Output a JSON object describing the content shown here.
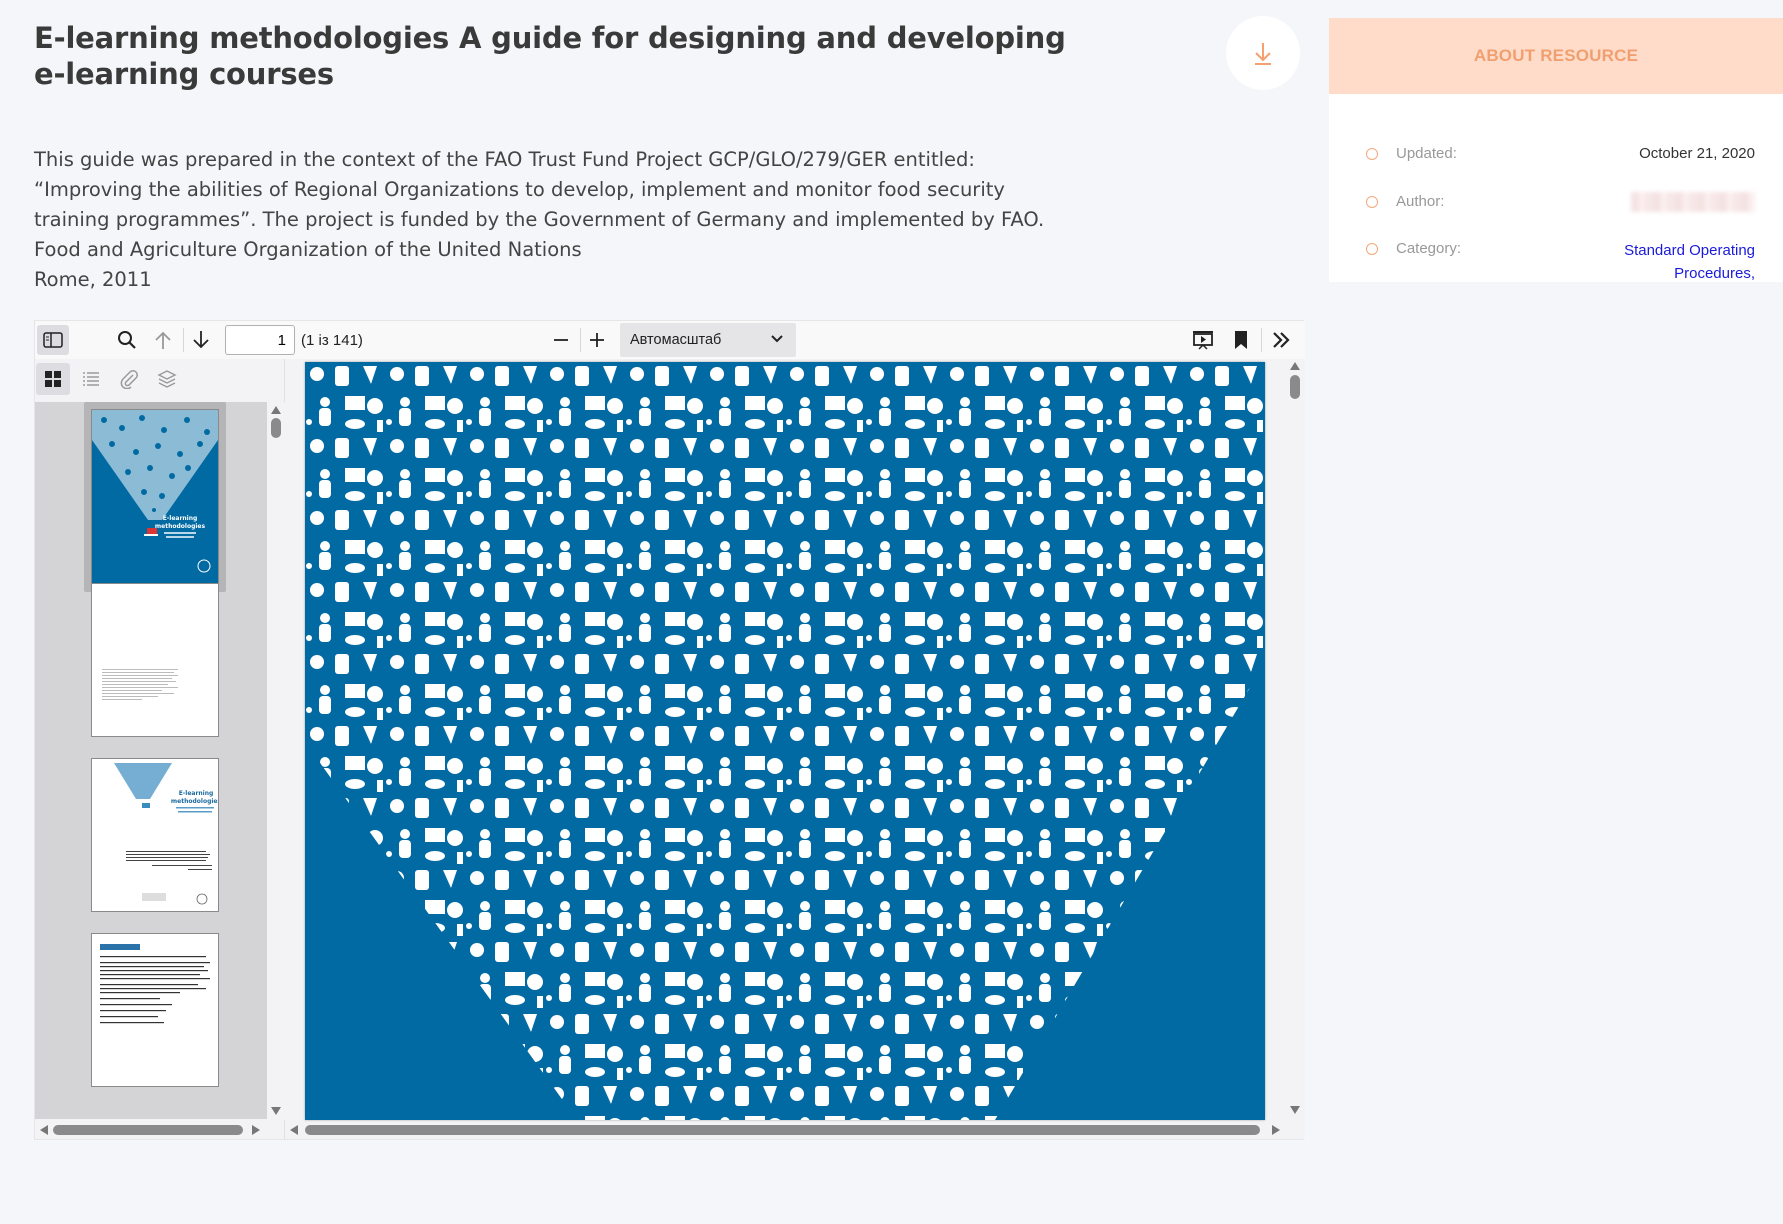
{
  "resource": {
    "title": "E-learning methodologies A guide for designing and developing e-learning courses",
    "description_lines": [
      "This guide was prepared in the context of the FAO Trust Fund Project GCP/GLO/279/GER entitled:",
      "“Improving the abilities of Regional Organizations to develop, implement and monitor food security",
      "training programmes”. The project is funded by the Government of Germany and implemented by FAO.",
      "Food and Agriculture Organization of the United Nations",
      "Rome, 2011"
    ],
    "download_icon": "download-arrow-icon"
  },
  "about": {
    "header": "ABOUT RESOURCE",
    "rows": [
      {
        "label": "Updated:",
        "value": "October 21, 2020"
      },
      {
        "label": "Author:",
        "value": ""
      },
      {
        "label": "Category:",
        "value_lines": [
          "Standard Operating",
          "Procedures,"
        ]
      }
    ],
    "accent_color": "#f7a77a",
    "header_bg": "#ffdcc9"
  },
  "viewer": {
    "page_input": "1",
    "page_count": "(1 із 141)",
    "zoom": "Автомасштаб",
    "icons": {
      "sidebar_toggle": "sidebar-toggle-icon",
      "search": "search-icon",
      "prev": "arrow-up-icon",
      "next": "arrow-down-icon",
      "zoom_out": "minus-icon",
      "zoom_in": "plus-icon",
      "presentation": "presentation-icon",
      "bookmark": "bookmark-icon",
      "tools": "double-chevron-right-icon"
    },
    "sidebar_tabs": [
      "thumbnails-icon",
      "outline-icon",
      "attachments-icon",
      "layers-icon"
    ],
    "cover_color": "#016aa3",
    "thumb_cover_lines": [
      "E-learning",
      "methodologies"
    ]
  }
}
